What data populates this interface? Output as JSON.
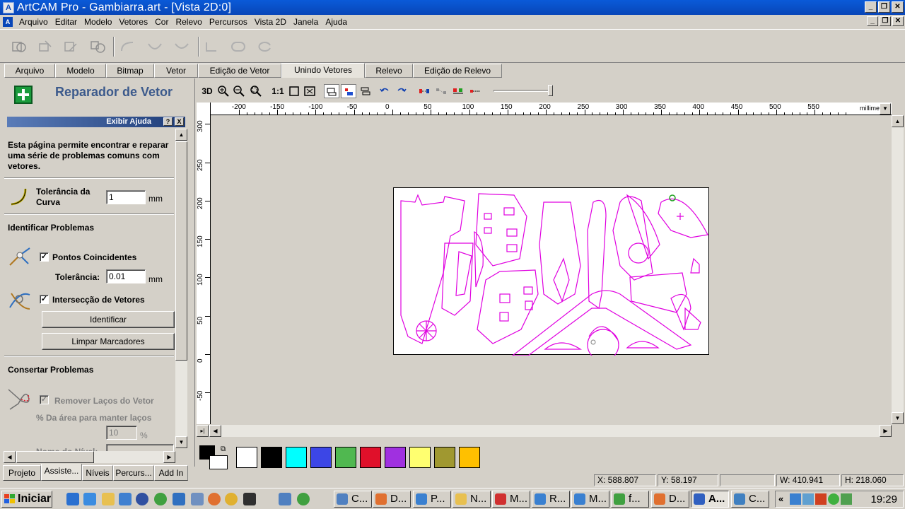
{
  "window": {
    "title": "ArtCAM Pro - Gambiarra.art - [Vista 2D:0]"
  },
  "menu": [
    "Arquivo",
    "Editar",
    "Modelo",
    "Vetores",
    "Cor",
    "Relevo",
    "Percursos",
    "Vista 2D",
    "Janela",
    "Ajuda"
  ],
  "tabs": [
    "Arquivo",
    "Modelo",
    "Bitmap",
    "Vetor",
    "Edição de Vetor",
    "Unindo Vetores",
    "Relevo",
    "Edição de Relevo"
  ],
  "active_tab": "Unindo Vetores",
  "panel": {
    "title": "Reparador de Vetor",
    "help_label": "Exibir Ajuda",
    "help_q": "?",
    "help_x": "X",
    "description": "Esta página permite encontrar e reparar uma série de problemas comuns com vetores.",
    "curve_tolerance_label_1": "Tolerância da",
    "curve_tolerance_label_2": "Curva",
    "curve_tolerance_value": "1",
    "unit_mm": "mm",
    "identify_heading": "Identificar Problemas",
    "coincident_points_label": "Pontos Coincidentes",
    "coincident_checked": "✓",
    "tolerance_label": "Tolerância:",
    "tolerance_value": "0.01",
    "intersection_label": "Intersecção de Vetores",
    "intersection_checked": "✓",
    "identify_button": "Identificar",
    "clear_markers_button": "Limpar Marcadores",
    "fix_heading": "Consertar Problemas",
    "remove_loops_label": "Remover Laços do Vetor",
    "remove_loops_checked": "✓",
    "area_label": "% Da área para manter laços",
    "area_value": "10",
    "percent": "%",
    "layer_name_label": "Nome do Nível:"
  },
  "bottom_tabs": [
    "Projeto",
    "Assiste...",
    "Níveis",
    "Percurs...",
    "Add In"
  ],
  "view_toolbar": {
    "label_3d": "3D",
    "label_11": "1:1"
  },
  "ruler": {
    "h_labels": [
      "-200",
      "-150",
      "-100",
      "-50",
      "0",
      "50",
      "100",
      "150",
      "200",
      "250",
      "300",
      "350",
      "400",
      "450",
      "500",
      "550"
    ],
    "v_labels": [
      "300",
      "250",
      "200",
      "150",
      "100",
      "50",
      "0",
      "-50"
    ],
    "units": "millimetres"
  },
  "palette": {
    "colors": [
      "#ffffff",
      "#000000",
      "#00ffff",
      "#3c46e6",
      "#50b850",
      "#e0102a",
      "#a030e0",
      "#ffff70",
      "#a09830",
      "#ffc000"
    ]
  },
  "status": {
    "x": "X: 588.807",
    "y": "Y: 58.197",
    "w": "W: 410.941",
    "h": "H: 218.060"
  },
  "taskbar": {
    "start": "Iniciar",
    "tasks": [
      "C...",
      "D...",
      "P...",
      "N...",
      "M...",
      "R...",
      "M...",
      "f...",
      "D...",
      "A...",
      "C..."
    ],
    "active_task": "A...",
    "clock": "19:29"
  }
}
